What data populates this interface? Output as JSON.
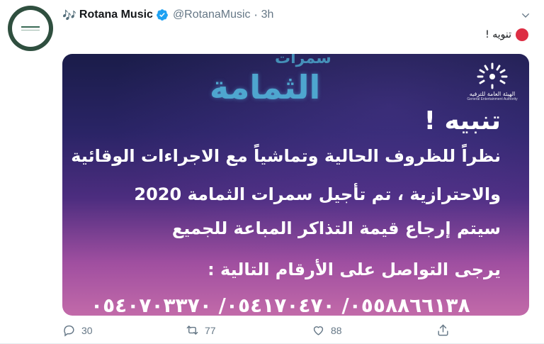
{
  "tweet": {
    "author": {
      "display_name": "Rotana Music",
      "name_emoji": "🎶",
      "handle": "@RotanaMusic",
      "verified": true
    },
    "separator": "·",
    "time": "3h",
    "text": "تنويه !",
    "media": {
      "event_logo_top": "سمرات",
      "event_logo_main": "الثمامة",
      "org_name_ar": "الهيئة العامة للترفيه",
      "org_name_en": "General Entertainment Authority",
      "title": "تنبيه !",
      "lines": [
        "نظراً للظروف الحالية وتماشياً مع الاجراءات الوقائية",
        "والاحترازية ، تم تأجيل سمرات الثمامة 2020",
        "سيتم إرجاع قيمة التذاكر المباعة للجميع",
        "يرجى التواصل على الأرقام التالية :"
      ],
      "phones": "٠٥٥٨٨٦٦١٣٨/ ٠٥٤١٧٠٤٧٠/ ٠٥٤٠٧٠٣٣٧٠"
    },
    "actions": {
      "reply_count": "30",
      "retweet_count": "77",
      "like_count": "88"
    }
  },
  "icons": {
    "reply": "comment-bubble-icon",
    "retweet": "retweet-icon",
    "like": "heart-icon",
    "share": "share-icon",
    "menu": "chevron-down-icon",
    "verified": "verified-badge-icon"
  },
  "colors": {
    "verified_blue": "#1da1f2",
    "secondary_text": "#657786",
    "red_circle": "#dd2e44"
  }
}
